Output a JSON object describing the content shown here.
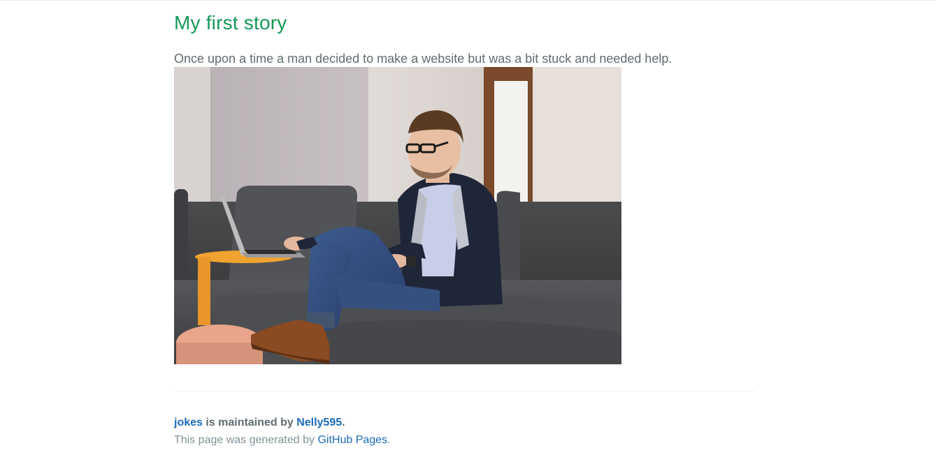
{
  "story": {
    "title": "My first story",
    "text": "Once upon a time a man decided to make a website but was a bit stuck and needed help."
  },
  "image": {
    "subject": "man-with-laptop-on-sofa"
  },
  "footer": {
    "project_link": "jokes",
    "maintained_by_text": " is maintained by ",
    "owner_link": "Nelly595",
    "owner_suffix": ".",
    "credits_prefix": "This page was generated by ",
    "credits_link": "GitHub Pages",
    "credits_suffix": "."
  },
  "colors": {
    "title": "#159957",
    "text": "#606c71",
    "link": "#1e6bb8",
    "muted": "#819198"
  }
}
